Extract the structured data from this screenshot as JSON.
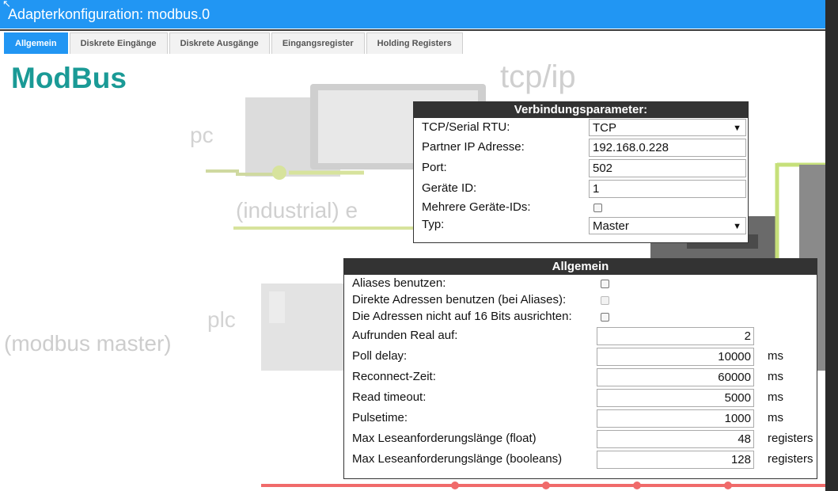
{
  "window": {
    "title": "Adapterkonfiguration: modbus.0"
  },
  "tabs": [
    {
      "label": "Allgemein",
      "active": true
    },
    {
      "label": "Diskrete Eingänge",
      "active": false
    },
    {
      "label": "Diskrete Ausgänge",
      "active": false
    },
    {
      "label": "Eingangsregister",
      "active": false
    },
    {
      "label": "Holding Registers",
      "active": false
    }
  ],
  "logo": {
    "title": "ModBus"
  },
  "background": {
    "tcpip": "tcp/ip",
    "pc": "pc",
    "industrial": "(industrial) e",
    "plc": "plc",
    "plc_sub": "(modbus master)"
  },
  "connection": {
    "header": "Verbindungsparameter:",
    "tcp_serial_label": "TCP/Serial RTU:",
    "tcp_serial_value": "TCP",
    "ip_label": "Partner IP Adresse:",
    "ip_value": "192.168.0.228",
    "port_label": "Port:",
    "port_value": "502",
    "device_id_label": "Geräte ID:",
    "device_id_value": "1",
    "multi_ids_label": "Mehrere Geräte-IDs:",
    "multi_ids_checked": false,
    "type_label": "Typ:",
    "type_value": "Master"
  },
  "general": {
    "header": "Allgemein",
    "aliases_label": "Aliases benutzen:",
    "direct_label": "Direkte Adressen benutzen (bei Aliases):",
    "align_label": "Die Adressen nicht auf 16 Bits ausrichten:",
    "round_label": "Aufrunden Real auf:",
    "round_value": "2",
    "poll_label": "Poll delay:",
    "poll_value": "10000",
    "poll_unit": "ms",
    "reconnect_label": "Reconnect-Zeit:",
    "reconnect_value": "60000",
    "reconnect_unit": "ms",
    "read_timeout_label": "Read timeout:",
    "read_timeout_value": "5000",
    "read_timeout_unit": "ms",
    "pulse_label": "Pulsetime:",
    "pulse_value": "1000",
    "pulse_unit": "ms",
    "max_float_label": "Max Leseanforderungslänge (float)",
    "max_float_value": "48",
    "max_float_unit": "registers",
    "max_bool_label": "Max Leseanforderungslänge (booleans)",
    "max_bool_value": "128",
    "max_bool_unit": "registers"
  },
  "colors": {
    "accent": "#2196f3",
    "logo": "#1a9a96",
    "panel_header": "#333333"
  }
}
